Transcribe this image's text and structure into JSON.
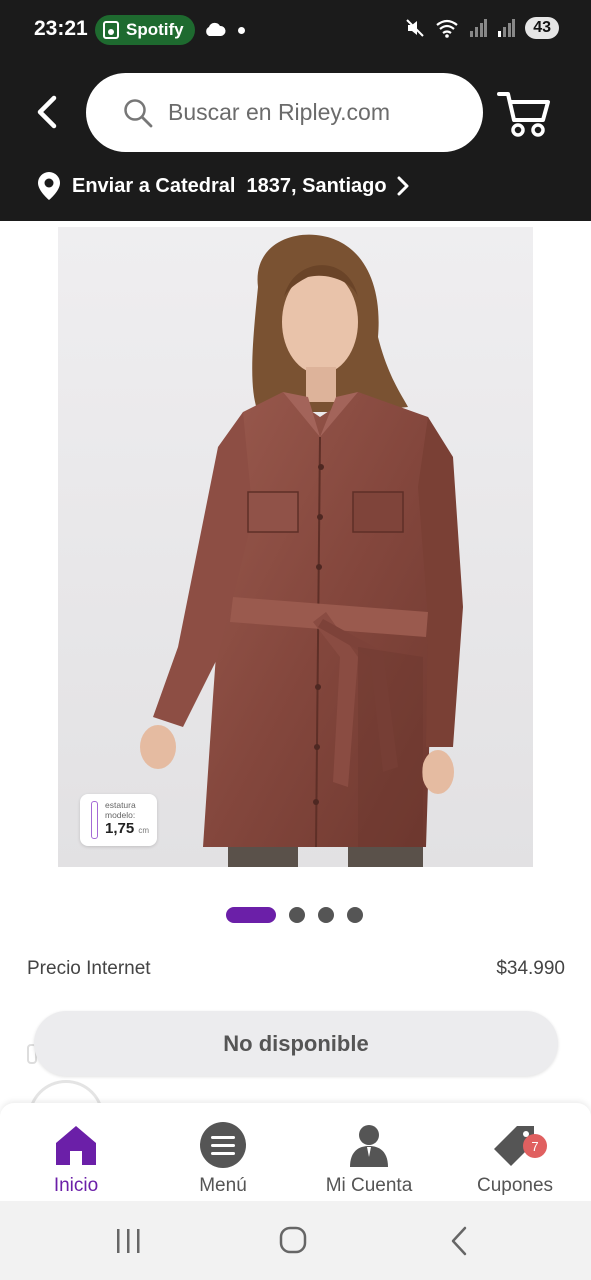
{
  "status_bar": {
    "time": "23:21",
    "spotify_label": "Spotify",
    "battery": "43"
  },
  "header": {
    "search_placeholder": "Buscar en Ripley.com",
    "shipping_text": "Enviar a Catedral  1837, Santiago",
    "icons": [
      "back-arrow-icon",
      "search-icon",
      "cart-icon",
      "location-pin-icon",
      "chevron-right-icon"
    ]
  },
  "product": {
    "model_height_label": "estatura modelo:",
    "model_height_value": "1,75",
    "model_height_unit": "cm",
    "carousel": {
      "total": 4,
      "active_index": 0
    },
    "price_label": "Precio Internet",
    "price_value": "$34.990",
    "status_button": "No disponible"
  },
  "bottom_nav": {
    "items": [
      {
        "label": "Inicio",
        "icon": "home-icon",
        "active": true
      },
      {
        "label": "Menú",
        "icon": "menu-icon",
        "active": false
      },
      {
        "label": "Mi Cuenta",
        "icon": "account-icon",
        "active": false
      },
      {
        "label": "Cupones",
        "icon": "coupon-icon",
        "active": false,
        "badge": "7"
      }
    ]
  },
  "colors": {
    "header_bg": "#1b1b1b",
    "accent": "#6b1fa8",
    "coupon_badge": "#e06060",
    "spotify_pill": "#1e6a2f"
  }
}
